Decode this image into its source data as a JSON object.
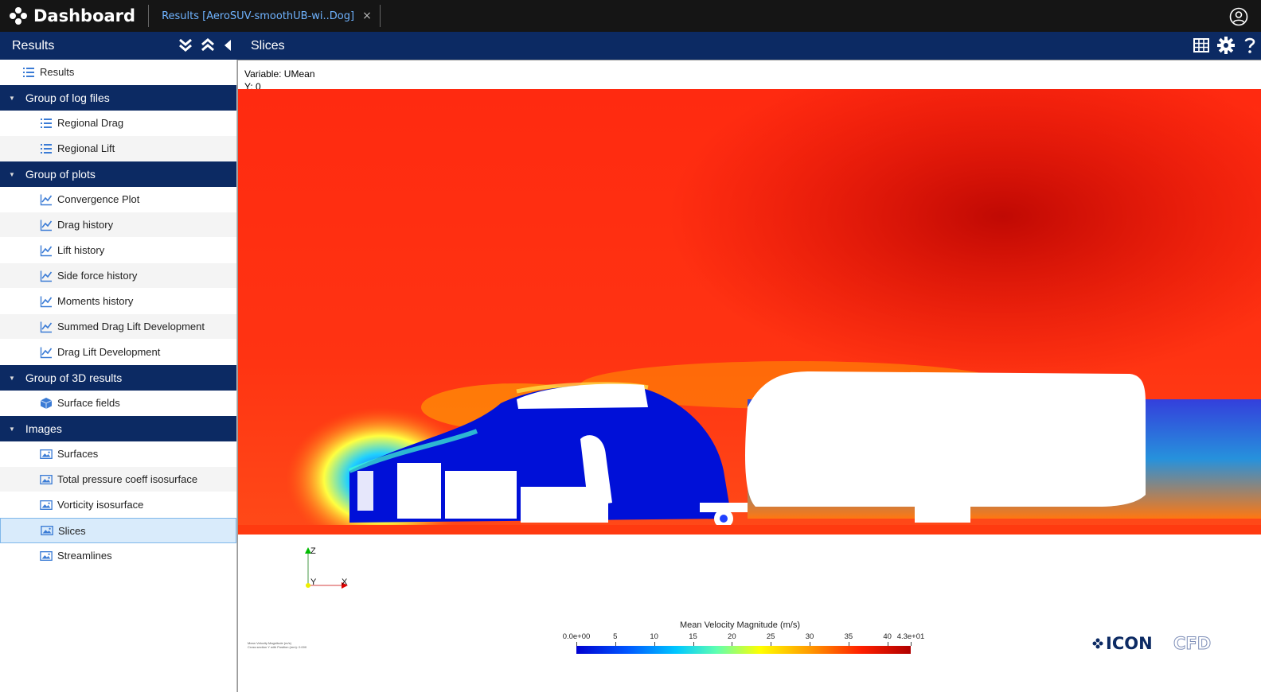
{
  "topbar": {
    "brand": "Dashboard",
    "tab_label": "Results [AeroSUV-smoothUB-wi..Dog]",
    "tab_close": "×"
  },
  "sidebar": {
    "title": "Results",
    "items": [
      {
        "kind": "root",
        "label": "Results",
        "icon": "list-icon"
      },
      {
        "kind": "group",
        "label": "Group of log files"
      },
      {
        "kind": "child",
        "label": "Regional Drag",
        "icon": "list-icon"
      },
      {
        "kind": "child",
        "label": "Regional Lift",
        "icon": "list-icon"
      },
      {
        "kind": "group",
        "label": "Group of plots"
      },
      {
        "kind": "child",
        "label": "Convergence Plot",
        "icon": "chart-icon"
      },
      {
        "kind": "child",
        "label": "Drag history",
        "icon": "chart-icon"
      },
      {
        "kind": "child",
        "label": "Lift history",
        "icon": "chart-icon"
      },
      {
        "kind": "child",
        "label": "Side force history",
        "icon": "chart-icon"
      },
      {
        "kind": "child",
        "label": "Moments history",
        "icon": "chart-icon"
      },
      {
        "kind": "child",
        "label": "Summed Drag Lift Development",
        "icon": "chart-icon"
      },
      {
        "kind": "child",
        "label": "Drag Lift Development",
        "icon": "chart-icon"
      },
      {
        "kind": "group",
        "label": "Group of 3D results"
      },
      {
        "kind": "child",
        "label": "Surface fields",
        "icon": "cube-icon"
      },
      {
        "kind": "group",
        "label": "Images"
      },
      {
        "kind": "child",
        "label": "Surfaces",
        "icon": "image-icon"
      },
      {
        "kind": "child",
        "label": "Total pressure coeff isosurface",
        "icon": "image-icon"
      },
      {
        "kind": "child",
        "label": "Vorticity isosurface",
        "icon": "image-icon"
      },
      {
        "kind": "child",
        "label": "Slices",
        "icon": "image-icon",
        "selected": true
      },
      {
        "kind": "child",
        "label": "Streamlines",
        "icon": "image-icon"
      }
    ]
  },
  "viewer": {
    "title": "Slices",
    "variable_line": "Variable: UMean",
    "y_line": "Y: 0",
    "axis_z": "Z",
    "axis_y": "Y",
    "axis_x": "X",
    "colorbar_title": "Mean Velocity Magnitude (m/s)",
    "colorbar_ticks": [
      {
        "label": "0.0e+00",
        "value": 0
      },
      {
        "label": "5",
        "value": 5
      },
      {
        "label": "10",
        "value": 10
      },
      {
        "label": "15",
        "value": 15
      },
      {
        "label": "20",
        "value": 20
      },
      {
        "label": "25",
        "value": 25
      },
      {
        "label": "30",
        "value": 30
      },
      {
        "label": "35",
        "value": 35
      },
      {
        "label": "40",
        "value": 40
      },
      {
        "label": "4.3e+01",
        "value": 43
      }
    ],
    "colorbar_max": 43,
    "footnote_line1": "Mean Velocity Magnitude (m/s)",
    "footnote_line2": "Cross section Y with Position (mm): 0.000",
    "logo_text_a": "ICON",
    "logo_text_b": "CFD"
  }
}
